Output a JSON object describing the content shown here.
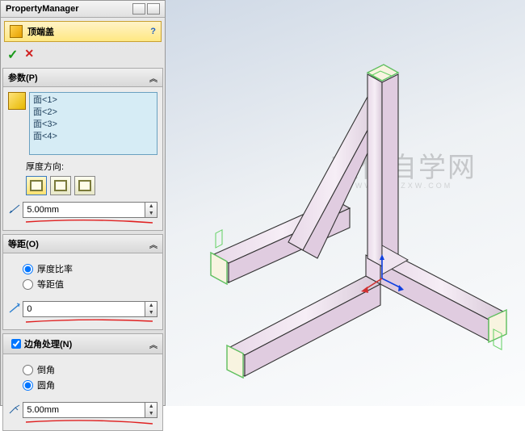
{
  "header": {
    "title": "PropertyManager"
  },
  "feature": {
    "title": "顶端盖",
    "help": "?"
  },
  "actions": {
    "ok": "✓",
    "cancel": "✕"
  },
  "params": {
    "title": "参数(P)",
    "faces": [
      "面<1>",
      "面<2>",
      "面<3>",
      "面<4>"
    ],
    "thickness_dir_label": "厚度方向:",
    "thickness_value": "5.00mm"
  },
  "offset": {
    "title": "等距(O)",
    "opt_ratio": "厚度比率",
    "opt_value": "等距值",
    "value": "0"
  },
  "corner": {
    "enabled": true,
    "title": "边角处理(N)",
    "opt_chamfer": "倒角",
    "opt_fillet": "圆角",
    "value": "5.00mm"
  },
  "watermark": {
    "main": "软件自学网",
    "sub": "WWW.RJZXW.COM"
  }
}
